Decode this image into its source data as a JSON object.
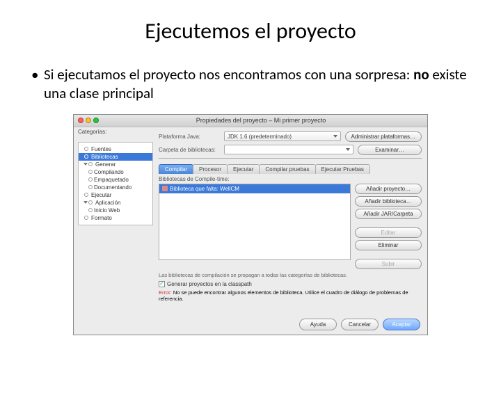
{
  "slide": {
    "title": "Ejecutemos el proyecto",
    "bullet_prefix": "Si ejecutamos el proyecto nos encontramos con una sorpresa: ",
    "bullet_bold": "no",
    "bullet_suffix": " existe una clase principal"
  },
  "dialog": {
    "title": "Propiedades del proyecto – Mi primer proyecto",
    "categories_label": "Categorías:",
    "tree": {
      "fuentes": "Fuentes",
      "bibliotecas": "Bibliotecas",
      "generar": "Generar",
      "compilando": "Compilando",
      "empaquetado": "Empaquetado",
      "documentando": "Documentando",
      "ejecutar": "Ejecutar",
      "aplicacion": "Aplicación",
      "inicio_web": "Inicio Web",
      "formato": "Formato"
    },
    "platform_label": "Plataforma Java:",
    "platform_value": "JDK 1.6 (predeterminado)",
    "libfolder_label": "Carpeta de bibliotecas:",
    "libfolder_value": "",
    "btn_manage_platforms": "Administrar plataformas…",
    "btn_browse": "Examinar…",
    "tabs": {
      "compilar": "Compilar",
      "procesor": "Procesor",
      "ejecutar": "Ejecutar",
      "compilar_pruebas": "Compilar pruebas",
      "ejecutar_pruebas": "Ejecutar Pruebas"
    },
    "listbox_label": "Bibliotecas de Compile-time:",
    "missing_lib": "Biblioteca que falta: WellCM",
    "btn_add_project": "Añadir proyecto…",
    "btn_add_library": "Añadir biblioteca…",
    "btn_add_jar": "Añadir JAR/Carpeta",
    "btn_edit": "Editar",
    "btn_remove": "Eliminar",
    "btn_up": "Subir",
    "note": "Las bibliotecas de compilación se propagan a todas las categorías de bibliotecas.",
    "chk_label": "Generar proyectos en la classpath",
    "error_label": "Error:",
    "error_text": " No se puede encontrar algunos elementos de biblioteca. Utilice el cuadro de diálogo de problemas de referencia.",
    "btn_help": "Ayuda",
    "btn_cancel": "Cancelar",
    "btn_accept": "Aceptar"
  }
}
